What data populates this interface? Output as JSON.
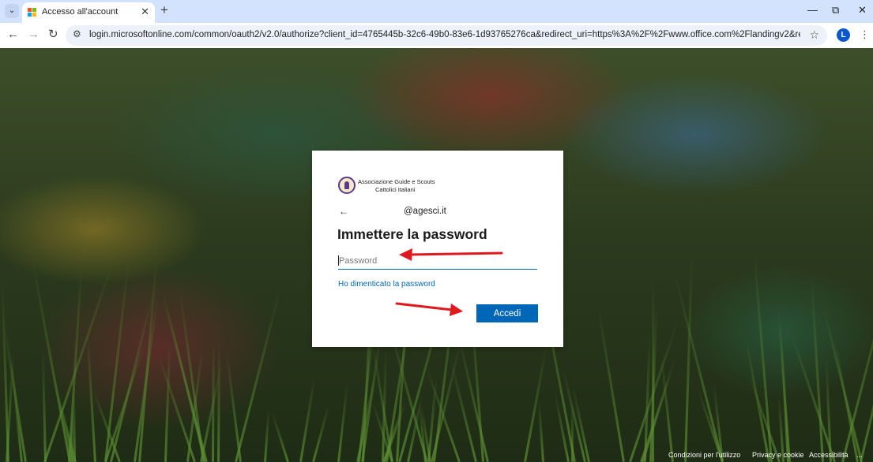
{
  "browser": {
    "tab": {
      "title": "Accesso all'account",
      "close_glyph": "✕"
    },
    "tab_search_glyph": "⌄",
    "newtab_glyph": "+",
    "window": {
      "minimize": "—",
      "restore": "⧉",
      "close": "✕"
    },
    "nav": {
      "back": "←",
      "forward": "→",
      "reload": "↻"
    },
    "site_info_glyph": "⚙",
    "url": "login.microsoftonline.com/common/oauth2/v2.0/authorize?client_id=4765445b-32c6-49b0-83e6-1d93765276ca&redirect_uri=https%3A%2F%2Fwww.office.com%2Flandingv2&response_type=code%2...",
    "bookmark_glyph": "☆",
    "profile_initial": "L",
    "menu_glyph": "⋮"
  },
  "signin": {
    "org_name_line1": "Associazione Guide e Scouts",
    "org_name_line2": "Cattolici Italiani",
    "back_glyph": "←",
    "identity": "@agesci.it",
    "heading": "Immettere la password",
    "password_placeholder": "Password",
    "password_value": "",
    "forgot_link": "Ho dimenticato la password",
    "submit_label": "Accedi"
  },
  "footer": {
    "terms": "Condizioni per l'utilizzo",
    "privacy": "Privacy e cookie",
    "accessibility": "Accessibilità",
    "more": "..."
  },
  "annotations": {
    "arrow_color": "#e0191e"
  },
  "colors": {
    "accent": "#0067b8",
    "tabbar": "#d3e3fd",
    "omnibox": "#edf2fa",
    "profile": "#0b57d0"
  }
}
